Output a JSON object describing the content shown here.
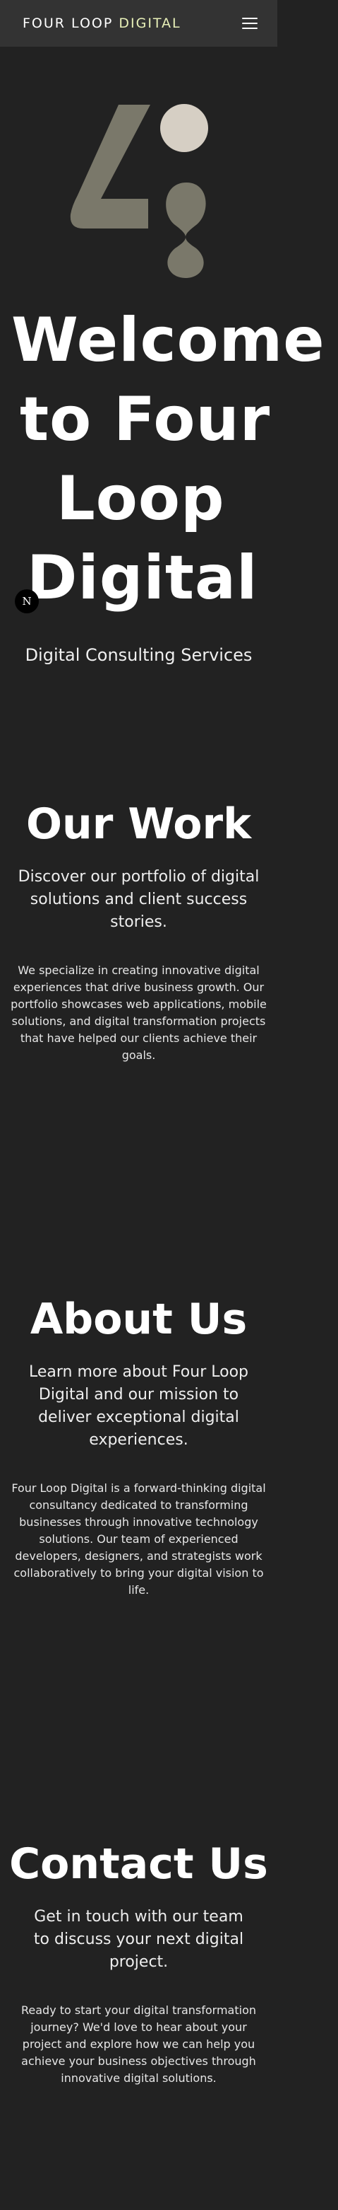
{
  "header": {
    "brand_main": "FOUR LOOP ",
    "brand_accent": "DIGITAL",
    "menu_icon": "hamburger-menu-icon"
  },
  "hero": {
    "logo_icon": "four-loop-digital-logo",
    "title_lines": [
      "Welcome",
      "to Four",
      "Loop",
      "Digital"
    ],
    "subtitle": "Digital Consulting Services",
    "badge": "N"
  },
  "work": {
    "title": "Our Work",
    "lead": "Discover our portfolio of digital solutions and client success stories.",
    "body": "We specialize in creating innovative digital experiences that drive business growth. Our portfolio showcases web applications, mobile solutions, and digital transformation projects that have helped our clients achieve their goals."
  },
  "about": {
    "title": "About Us",
    "lead": "Learn more about Four Loop Digital and our mission to deliver exceptional digital experiences.",
    "body": "Four Loop Digital is a forward-thinking digital consultancy dedicated to transforming businesses through innovative technology solutions. Our team of experienced developers, designers, and strategists work collaboratively to bring your digital vision to life."
  },
  "contact": {
    "title": "Contact Us",
    "lead": "Get in touch with our team to discuss your next digital project.",
    "body": "Ready to start your digital transformation journey? We'd love to hear about your project and explore how we can help you achieve your business objectives through innovative digital solutions."
  },
  "colors": {
    "background": "#222222",
    "header": "#333333",
    "accent": "#e8f0b8",
    "logo_primary": "#7a786a",
    "logo_dot": "#d6cfc4"
  }
}
